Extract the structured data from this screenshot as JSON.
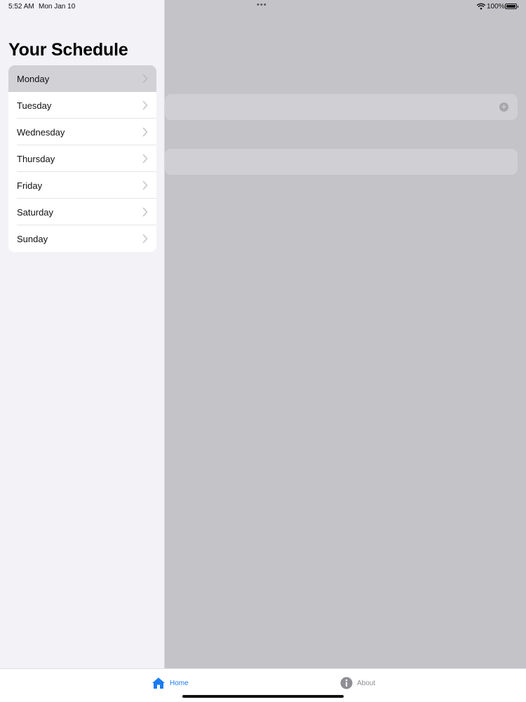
{
  "status_bar": {
    "time": "5:52 AM",
    "date": "Mon Jan 10",
    "multitask_dots": "•••",
    "battery_percent": "100%",
    "battery_level": 1.0,
    "wifi_icon": "wifi-icon",
    "battery_icon": "battery-icon"
  },
  "sidebar": {
    "title": "Your Schedule",
    "selected_index": 0,
    "days": [
      {
        "label": "Monday"
      },
      {
        "label": "Tuesday"
      },
      {
        "label": "Wednesday"
      },
      {
        "label": "Thursday"
      },
      {
        "label": "Friday"
      },
      {
        "label": "Saturday"
      },
      {
        "label": "Sunday"
      }
    ]
  },
  "detail": {
    "add_icon": "plus-circle-icon"
  },
  "tab_bar": {
    "tabs": [
      {
        "label": "Home",
        "icon": "house-icon",
        "selected": true
      },
      {
        "label": "About",
        "icon": "info-circle-icon",
        "selected": false
      }
    ]
  },
  "colors": {
    "accent": "#1a7cf0",
    "sidebar_bg": "#f2f2f7",
    "dimmed_bg": "#c4c3c8",
    "selected_row": "#d1d1d6",
    "inactive_tab": "#8e8e93"
  }
}
